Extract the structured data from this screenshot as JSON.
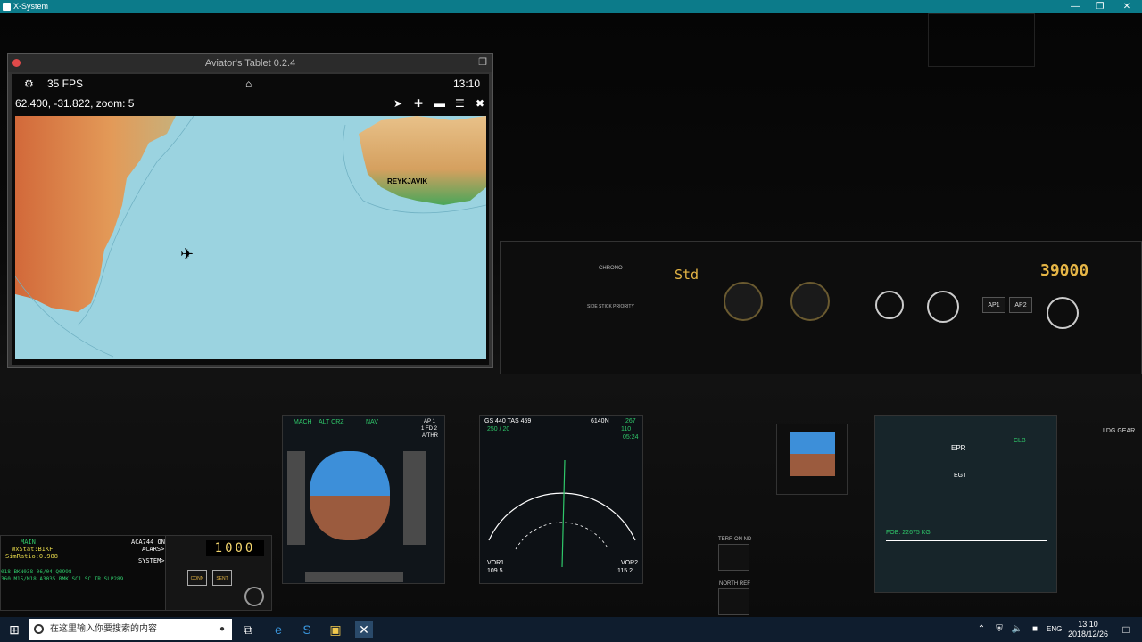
{
  "window": {
    "title": "X-System"
  },
  "tablet": {
    "title": "Aviator's Tablet  0.2.4",
    "fps": "35 FPS",
    "time": "13:10",
    "coords": "62.400, -31.822, zoom: 5",
    "map_city": "REYKJAVIK"
  },
  "cockpit": {
    "altitude_readout": "39000",
    "baro": "Std",
    "chrono_label": "CHRONO",
    "side_stick_label": "SIDE STICK PRIORITY",
    "fma": [
      "MACH",
      "ALT CRZ",
      "NAV",
      "AP 1",
      "1 FD 2",
      "A/THR"
    ],
    "nd_gs": "GS 440",
    "nd_tas": "TAS 459",
    "nd_wind": "250 / 20",
    "nd_wpt": "6140N",
    "nd_dist": "110",
    "nd_eta": "05:24",
    "nd_hdg": "267",
    "vor1": "VOR1",
    "vor1_freq": "109.5",
    "vor2": "VOR2",
    "vor2_freq": "115.2",
    "ewd_epr": "EPR",
    "ewd_egt": "EGT",
    "ewd_clb": "CLB",
    "ewd_fob": "FOB: 22675 KG",
    "xpdr_code": "1000",
    "acars_lines": [
      "MAIN",
      "WxStat:BIKF",
      "SimRatio:0.988",
      "ACA744 ON",
      "ACARS>",
      "SYSTEM>",
      "018 BKN038 06/04 Q0998",
      "360 M15/M18 A3035 RMK SC1 SC TR SLP289"
    ],
    "ldg_gear": "LDG GEAR",
    "terr_on_nd": "TERR ON ND",
    "north_ref": "NORTH REF"
  },
  "taskbar": {
    "search_placeholder": "在这里输入你要搜索的内容",
    "lang": "ENG",
    "time": "13:10",
    "date": "2018/12/26"
  }
}
